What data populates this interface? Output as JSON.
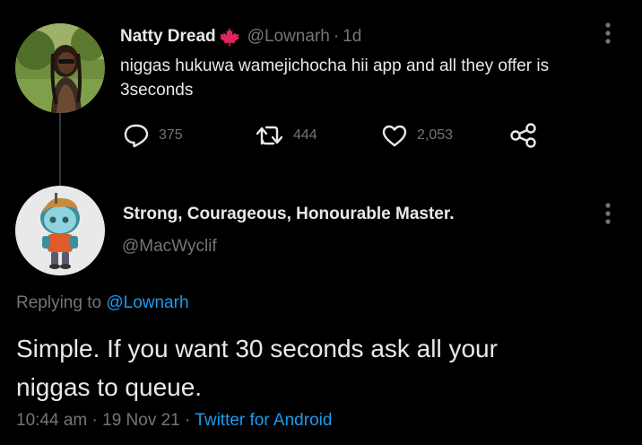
{
  "thread": {
    "parent": {
      "display_name": "Natty Dread",
      "handle": "@Lownarh",
      "separator": "·",
      "time": "1d",
      "body_lines": [
        "niggas hukuwa wamejichocha hii app and all they offer is",
        "3seconds"
      ],
      "actions": {
        "reply_count": "375",
        "retweet_count": "444",
        "like_count": "2,053"
      },
      "flag_icon": "maple-leaf-icon",
      "flag_color": "#e0245e"
    },
    "reply": {
      "display_name": "Strong, Courageous, Honourable Master.",
      "handle": "@MacWyclif",
      "replying_prefix": "Replying to",
      "replying_to": "@Lownarh",
      "body_lines": [
        "Simple. If you want 30 seconds ask all your",
        "niggas to queue."
      ],
      "time": "10:44 am",
      "separator": "·",
      "date": "19 Nov 21",
      "separator2": "·",
      "source": "Twitter for Android"
    }
  },
  "colors": {
    "background": "#000000",
    "text_primary": "#e7e9ea",
    "text_secondary": "#71767b",
    "link": "#1d9bf0",
    "thread_line": "#333639"
  },
  "icons": {
    "reply": "reply-icon",
    "retweet": "retweet-icon",
    "like": "heart-icon",
    "share": "share-icon",
    "more": "more-vertical-icon"
  }
}
